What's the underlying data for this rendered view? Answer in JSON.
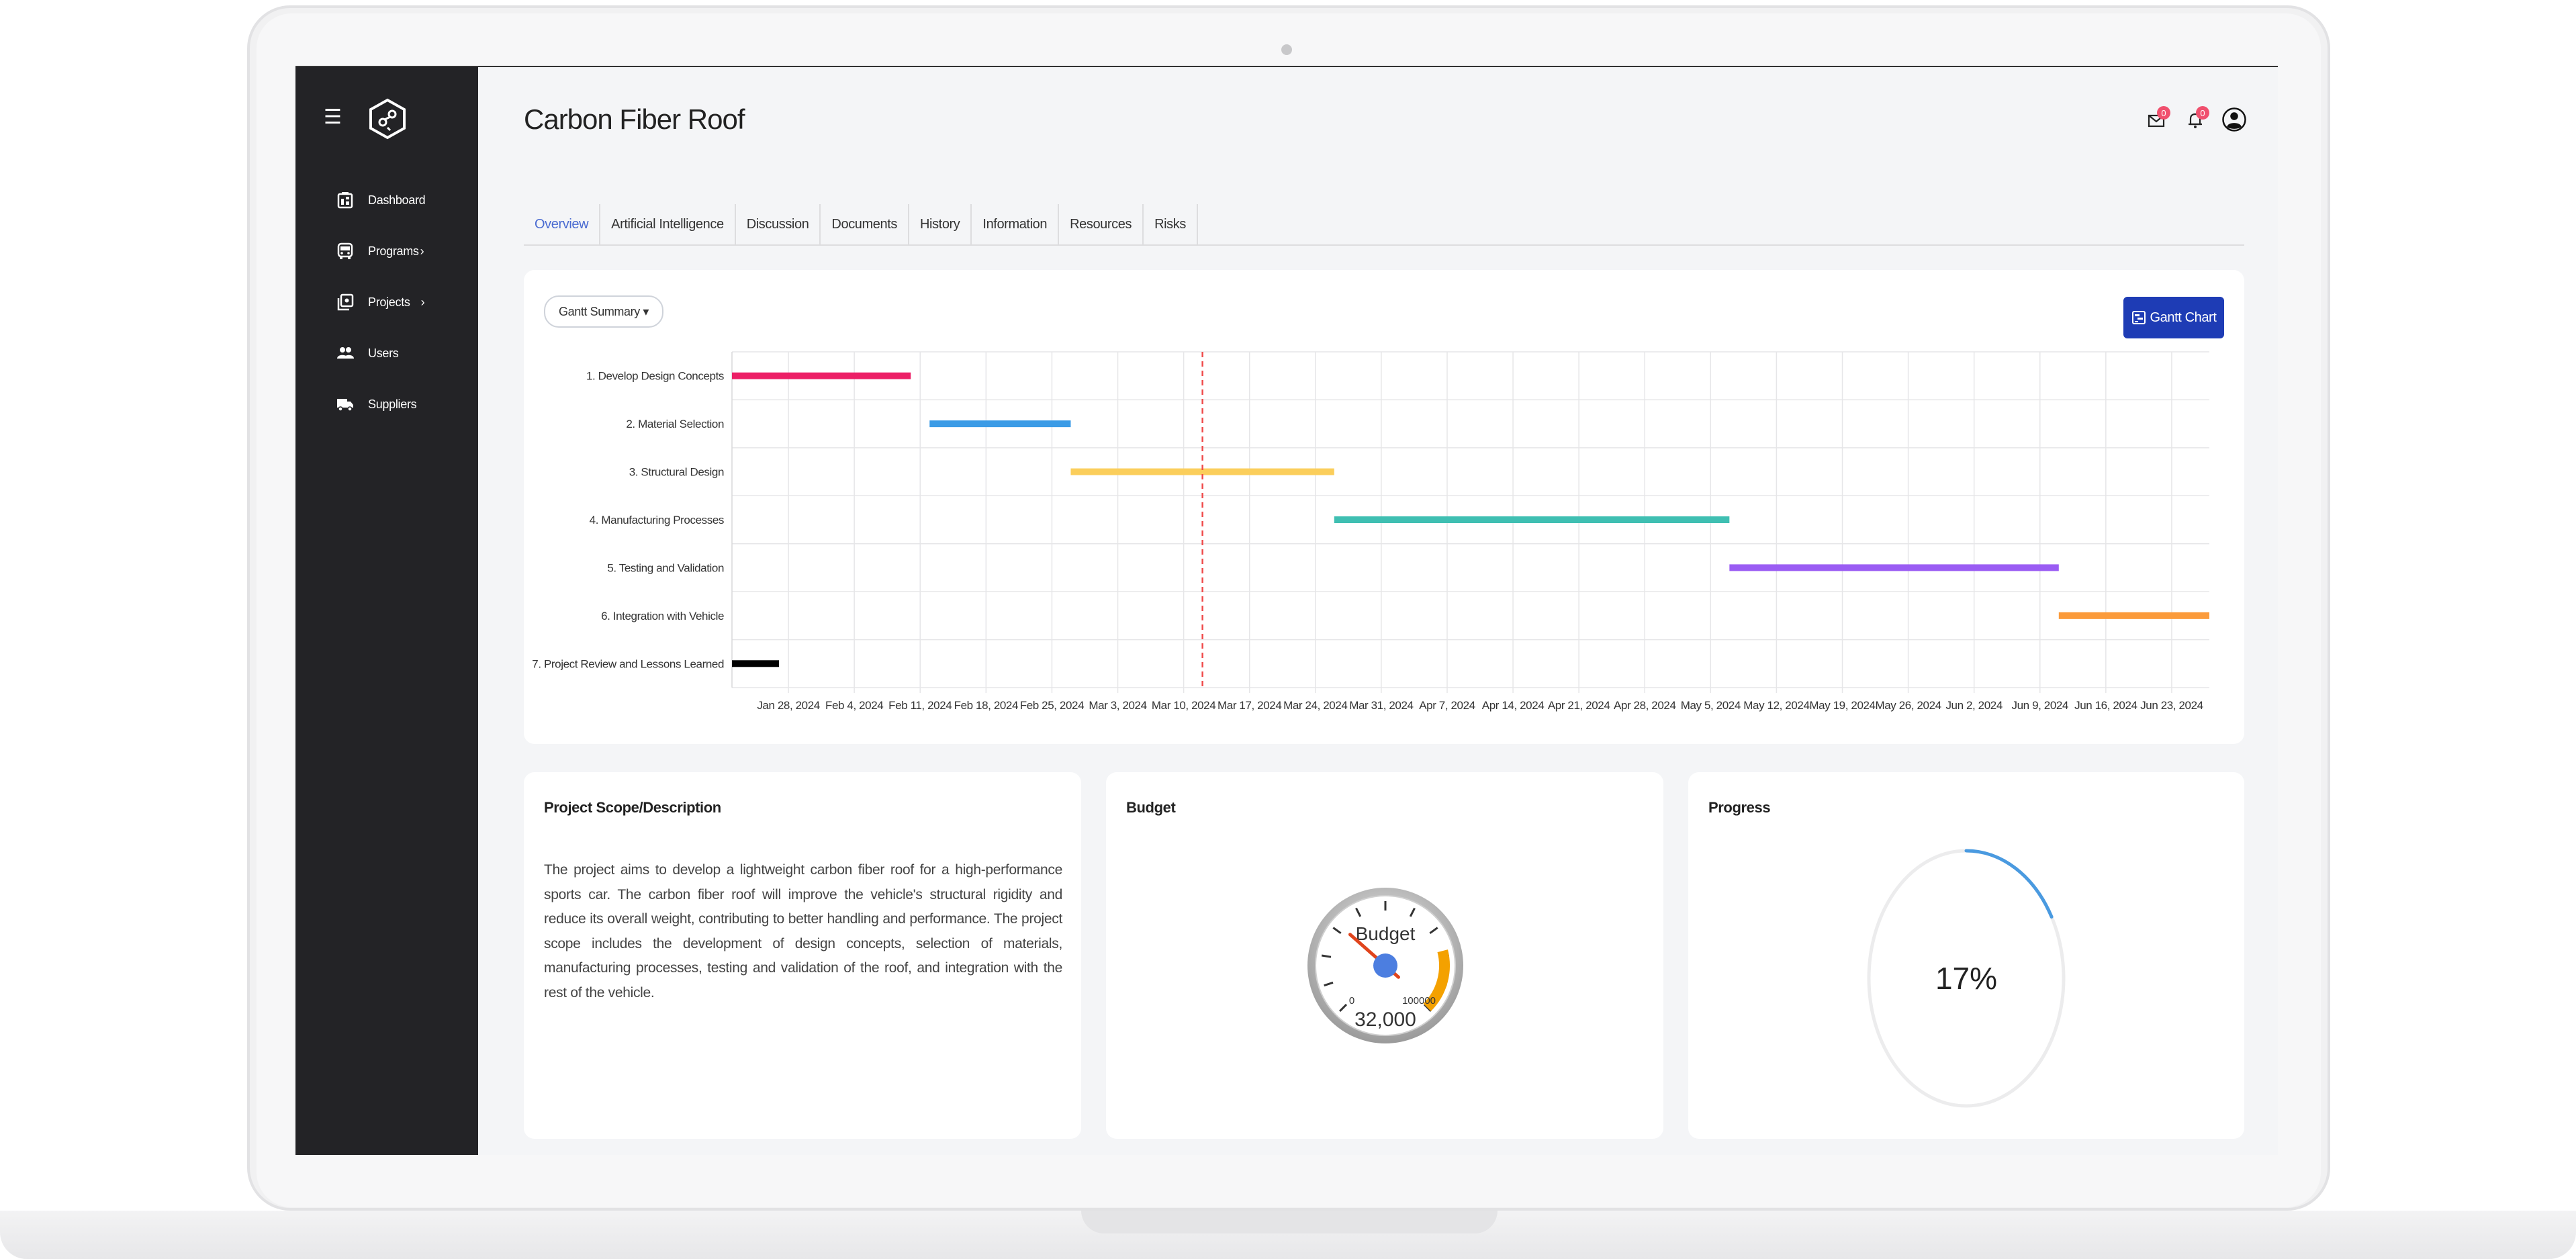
{
  "app": {
    "page_title": "Carbon Fiber Roof",
    "menu_icon": "hamburger-icon",
    "logo_icon": "hexagon-logo-icon",
    "accent_color": "#1e3cb5"
  },
  "sidebar": {
    "items": [
      {
        "label": "Dashboard",
        "icon": "dashboard-icon",
        "chevron": ""
      },
      {
        "label": "Programs",
        "icon": "bus-icon",
        "chevron": "›"
      },
      {
        "label": "Projects",
        "icon": "projects-icon",
        "chevron": "›"
      },
      {
        "label": "Users",
        "icon": "users-icon",
        "chevron": ""
      },
      {
        "label": "Suppliers",
        "icon": "truck-icon",
        "chevron": ""
      }
    ]
  },
  "header": {
    "mail_badge": "0",
    "bell_badge": "0"
  },
  "tabs": [
    {
      "label": "Overview",
      "active": true
    },
    {
      "label": "Artificial Intelligence",
      "active": false
    },
    {
      "label": "Discussion",
      "active": false
    },
    {
      "label": "Documents",
      "active": false
    },
    {
      "label": "History",
      "active": false
    },
    {
      "label": "Information",
      "active": false
    },
    {
      "label": "Resources",
      "active": false
    },
    {
      "label": "Risks",
      "active": false
    }
  ],
  "gantt": {
    "dropdown_label": "Gantt Summary ▾",
    "button_label": "Gantt Chart",
    "chart_data": {
      "type": "gantt",
      "x_start": "2024-01-22",
      "x_end": "2024-06-27",
      "today": "2024-03-12",
      "ticks": [
        "Jan 28, 2024",
        "Feb 4, 2024",
        "Feb 11, 2024",
        "Feb 18, 2024",
        "Feb 25, 2024",
        "Mar 3, 2024",
        "Mar 10, 2024",
        "Mar 17, 2024",
        "Mar 24, 2024",
        "Mar 31, 2024",
        "Apr 7, 2024",
        "Apr 14, 2024",
        "Apr 21, 2024",
        "Apr 28, 2024",
        "May 5, 2024",
        "May 12, 2024",
        "May 19, 2024",
        "May 26, 2024",
        "Jun 2, 2024",
        "Jun 9, 2024",
        "Jun 16, 2024",
        "Jun 23, 2024"
      ],
      "tasks": [
        {
          "name": "1. Develop Design Concepts",
          "start": "2024-01-22",
          "end": "2024-02-10",
          "color": "#ec1f66"
        },
        {
          "name": "2. Material Selection",
          "start": "2024-02-12",
          "end": "2024-02-27",
          "color": "#3b9be6"
        },
        {
          "name": "3. Structural Design",
          "start": "2024-02-27",
          "end": "2024-03-26",
          "color": "#fbce5b"
        },
        {
          "name": "4. Manufacturing Processes",
          "start": "2024-03-26",
          "end": "2024-05-07",
          "color": "#3fbfb2"
        },
        {
          "name": "5. Testing and Validation",
          "start": "2024-05-07",
          "end": "2024-06-11",
          "color": "#9a5cf3"
        },
        {
          "name": "6. Integration with Vehicle",
          "start": "2024-06-11",
          "end": "2024-06-27",
          "color": "#fb9b3b"
        },
        {
          "name": "7. Project Review and Lessons Learned",
          "start": "2024-01-22",
          "end": "2024-01-27",
          "color": "#000000"
        }
      ]
    }
  },
  "scope": {
    "title": "Project Scope/Description",
    "text": "The project aims to develop a lightweight carbon fiber roof for a high-performance sports car. The carbon fiber roof will improve the vehicle's structural rigidity and reduce its overall weight, contributing to better handling and performance. The project scope includes the development of design concepts, selection of materials, manufacturing processes, testing and validation of the roof, and integration with the rest of the vehicle."
  },
  "budget": {
    "title": "Budget",
    "gauge_label": "Budget",
    "min_label": "0",
    "max_label": "100000",
    "min": 0,
    "max": 100000,
    "value": 32000,
    "value_label": "32,000"
  },
  "progress": {
    "title": "Progress",
    "percent": 17,
    "percent_label": "17%",
    "arc_color": "#4a9ae0"
  }
}
